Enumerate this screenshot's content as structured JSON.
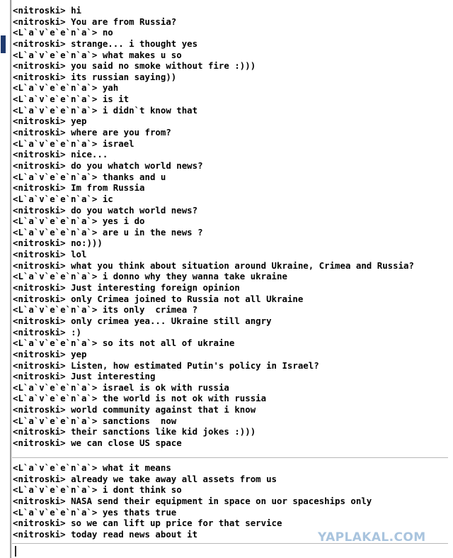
{
  "window": {
    "background_color": "#ffffff",
    "text_color": "#000000",
    "border_color": "#9d9d9d",
    "marker_color": "#1f3a6e"
  },
  "nicks": {
    "self": "<nitroski>",
    "peer": "<L`a`v`e`e`n`a`>"
  },
  "chat": {
    "upper_messages": [
      {
        "nick": "<nitroski>",
        "text": "hi"
      },
      {
        "nick": "<nitroski>",
        "text": "You are from Russia?"
      },
      {
        "nick": "<L`a`v`e`e`n`a`>",
        "text": "no"
      },
      {
        "nick": "<nitroski>",
        "text": "strange... i thought yes"
      },
      {
        "nick": "<L`a`v`e`e`n`a`>",
        "text": "what makes u so"
      },
      {
        "nick": "<nitroski>",
        "text": "you said no smoke without fire :)))"
      },
      {
        "nick": "<nitroski>",
        "text": "its russian saying))"
      },
      {
        "nick": "<L`a`v`e`e`n`a`>",
        "text": "yah"
      },
      {
        "nick": "<L`a`v`e`e`n`a`>",
        "text": "is it"
      },
      {
        "nick": "<L`a`v`e`e`n`a`>",
        "text": "i didn`t know that"
      },
      {
        "nick": "<nitroski>",
        "text": "yep"
      },
      {
        "nick": "<nitroski>",
        "text": "where are you from?"
      },
      {
        "nick": "<L`a`v`e`e`n`a`>",
        "text": "israel"
      },
      {
        "nick": "<nitroski>",
        "text": "nice..."
      },
      {
        "nick": "<nitroski>",
        "text": "do you whatch world news?"
      },
      {
        "nick": "<L`a`v`e`e`n`a`>",
        "text": "thanks and u"
      },
      {
        "nick": "<nitroski>",
        "text": "Im from Russia"
      },
      {
        "nick": "<L`a`v`e`e`n`a`>",
        "text": "ic"
      },
      {
        "nick": "<nitroski>",
        "text": "do you watch world news?"
      },
      {
        "nick": "<L`a`v`e`e`n`a`>",
        "text": "yes i do"
      },
      {
        "nick": "<L`a`v`e`e`n`a`>",
        "text": "are u in the news ?"
      },
      {
        "nick": "<nitroski>",
        "text": "no:)))"
      },
      {
        "nick": "<nitroski>",
        "text": "lol"
      },
      {
        "nick": "<nitroski>",
        "text": "what you think about situation around Ukraine, Crimea and Russia?"
      },
      {
        "nick": "<L`a`v`e`e`n`a`>",
        "text": "i donno why they wanna take ukraine"
      },
      {
        "nick": "<nitroski>",
        "text": "Just interesting foreign opinion"
      },
      {
        "nick": "<nitroski>",
        "text": "only Crimea joined to Russia not all Ukraine"
      },
      {
        "nick": "<L`a`v`e`e`n`a`>",
        "text": "its only  crimea ?"
      },
      {
        "nick": "<nitroski>",
        "text": "only crimea yea... Ukraine still angry"
      },
      {
        "nick": "<nitroski>",
        "text": ":)"
      },
      {
        "nick": "<L`a`v`e`e`n`a`>",
        "text": "so its not all of ukraine"
      },
      {
        "nick": "<nitroski>",
        "text": "yep"
      },
      {
        "nick": "<nitroski>",
        "text": "Listen, how estimated Putin's policy in Israel?"
      },
      {
        "nick": "<nitroski>",
        "text": "Just interesting"
      },
      {
        "nick": "<L`a`v`e`e`n`a`>",
        "text": "israel is ok with russia"
      },
      {
        "nick": "<L`a`v`e`e`n`a`>",
        "text": "the world is not ok with russia"
      },
      {
        "nick": "<nitroski>",
        "text": "world community against that i know"
      },
      {
        "nick": "<L`a`v`e`e`n`a`>",
        "text": "sanctions  now"
      },
      {
        "nick": "<nitroski>",
        "text": "their sanctions like kid jokes :)))"
      },
      {
        "nick": "<nitroski>",
        "text": "we can close US space"
      }
    ],
    "lower_messages": [
      {
        "nick": "<L`a`v`e`e`n`a`>",
        "text": "what it means"
      },
      {
        "nick": "<nitroski>",
        "text": "already we take away all assets from us"
      },
      {
        "nick": "<L`a`v`e`e`n`a`>",
        "text": "i dont think so"
      },
      {
        "nick": "<nitroski>",
        "text": "NASA send their equipment in space on uor spaceships only"
      },
      {
        "nick": "<L`a`v`e`e`n`a`>",
        "text": "yes thats true"
      },
      {
        "nick": "<nitroski>",
        "text": "so we can lift up price for that service"
      },
      {
        "nick": "<nitroski>",
        "text": "today read news about it"
      }
    ]
  },
  "input": {
    "value": "",
    "placeholder": ""
  },
  "watermark": {
    "text": "YAPLAKAL.COM",
    "color": "#a9c4de"
  }
}
